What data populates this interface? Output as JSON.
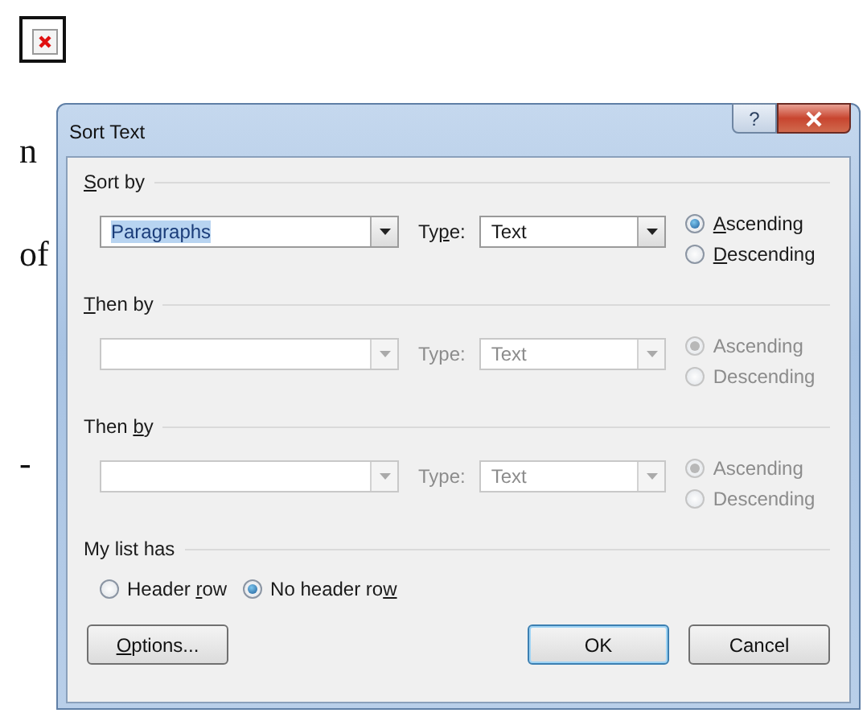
{
  "document": {
    "text_fragments": [
      "n",
      "of",
      "-"
    ]
  },
  "dialog": {
    "title": "Sort Text",
    "help_glyph": "?",
    "sections": [
      {
        "label": {
          "key": "S",
          "post": "ort by"
        },
        "disabled": false,
        "field": {
          "value": "Paragraphs",
          "highlighted": true
        },
        "type_label": {
          "pre": "Ty",
          "key": "p",
          "post": "e:"
        },
        "type_value": "Text",
        "orders": [
          {
            "label": {
              "key": "A",
              "post": "scending"
            },
            "selected": true
          },
          {
            "label": {
              "key": "D",
              "post": "escending"
            },
            "selected": false
          }
        ]
      },
      {
        "label": {
          "key": "T",
          "post": "hen by"
        },
        "disabled": true,
        "type_label": {
          "pre": "Type:"
        },
        "type_value": "Text",
        "orders": [
          {
            "label": {
              "pre": "Ascending"
            },
            "selected": true
          },
          {
            "label": {
              "pre": "Descending"
            },
            "selected": false
          }
        ]
      },
      {
        "label": {
          "pre": "Then ",
          "key": "b",
          "post": "y"
        },
        "disabled": true,
        "type_label": {
          "pre": "Type:"
        },
        "type_value": "Text",
        "orders": [
          {
            "label": {
              "pre": "Ascending"
            },
            "selected": true
          },
          {
            "label": {
              "pre": "Descending"
            },
            "selected": false
          }
        ]
      }
    ],
    "list_header": {
      "label": "My list has",
      "options": [
        {
          "label": {
            "pre": "Header ",
            "key": "r",
            "post": "ow"
          },
          "selected": false
        },
        {
          "label": {
            "pre": "No header ro",
            "key": "w"
          },
          "selected": true
        }
      ]
    },
    "buttons": [
      {
        "label": {
          "key": "O",
          "post": "ptions..."
        },
        "default": false
      },
      {
        "label": {
          "pre": "OK"
        },
        "default": true
      },
      {
        "label": {
          "pre": "Cancel"
        },
        "default": false
      }
    ]
  }
}
